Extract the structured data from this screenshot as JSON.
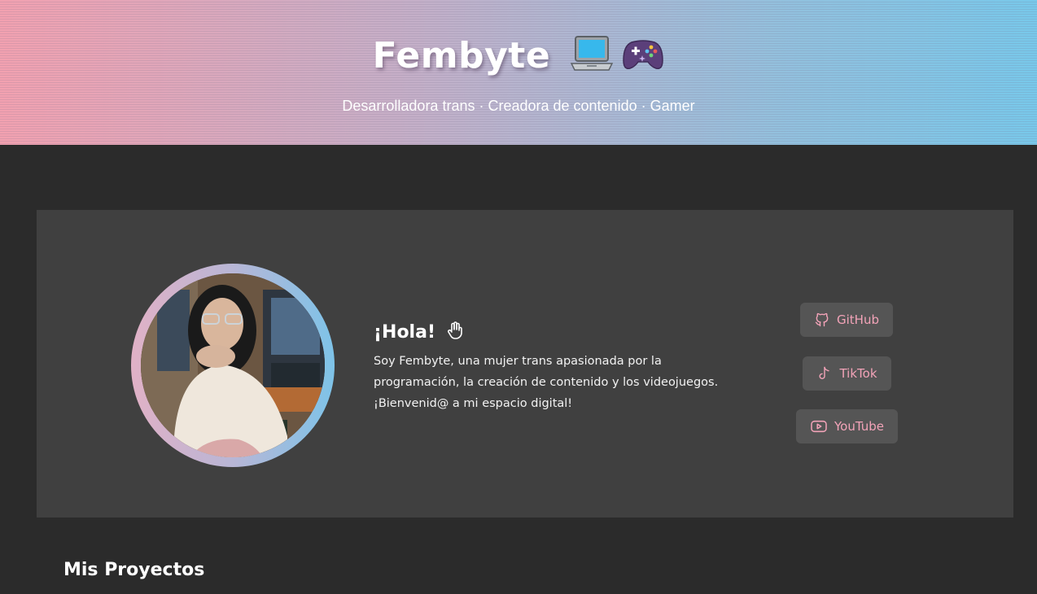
{
  "hero": {
    "title": "Fembyte",
    "subtitle": "Desarrolladora trans · Creadora de contenido · Gamer",
    "icons": [
      "laptop-icon",
      "gamepad-icon"
    ]
  },
  "intro": {
    "title": "¡Hola!",
    "title_icon": "waving-hand-icon",
    "paragraph": "Soy Fembyte, una mujer trans apasionada por la programación, la creación de contenido y los videojuegos. ¡Bienvenid@ a mi espacio digital!"
  },
  "social": [
    {
      "label": "GitHub",
      "icon": "github-icon"
    },
    {
      "label": "TikTok",
      "icon": "tiktok-icon"
    },
    {
      "label": "YouTube",
      "icon": "youtube-icon"
    }
  ],
  "projects": {
    "title": "Mis Proyectos"
  },
  "colors": {
    "accent_pink": "#f2a3b8",
    "accent_blue": "#78c8ea",
    "background": "#2b2b2b",
    "card": "#404040",
    "button": "#555555"
  }
}
